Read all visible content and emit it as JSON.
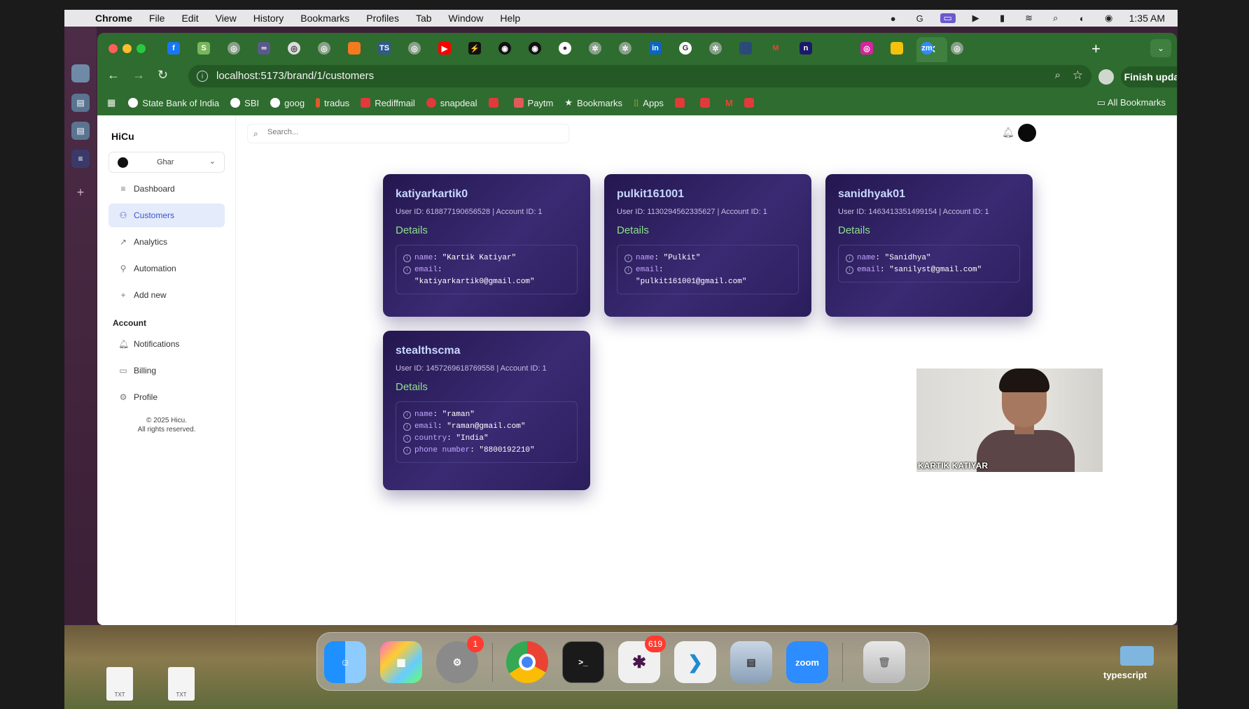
{
  "menubar": {
    "app": "Chrome",
    "items": [
      "File",
      "Edit",
      "View",
      "History",
      "Bookmarks",
      "Profiles",
      "Tab",
      "Window",
      "Help"
    ],
    "time": "1:35 AM"
  },
  "browser": {
    "url": "localhost:5173/brand/1/customers",
    "finish_update": "Finish update",
    "bookmarks": [
      {
        "label": "State Bank of India",
        "color": "#ffffff"
      },
      {
        "label": "SBI",
        "color": "#ffffff"
      },
      {
        "label": "goog",
        "color": "#ffffff"
      },
      {
        "label": "tradus",
        "color": "#e05a2a"
      },
      {
        "label": "Rediffmail",
        "color": "#e03a3a"
      },
      {
        "label": "snapdeal",
        "color": "#e03a3a"
      },
      {
        "label": "",
        "color": "#e03a3a"
      },
      {
        "label": "Paytm",
        "color": "#e05a5a"
      },
      {
        "label": "Bookmarks",
        "color": "#ffffff"
      },
      {
        "label": "Apps",
        "color": "#e0c040"
      }
    ],
    "all_bookmarks": "All Bookmarks"
  },
  "sidebar": {
    "brand": "HiCu",
    "workspace": "Ghar",
    "nav": [
      {
        "label": "Dashboard",
        "icon": "≡"
      },
      {
        "label": "Customers",
        "icon": "👥"
      },
      {
        "label": "Analytics",
        "icon": "↗"
      },
      {
        "label": "Automation",
        "icon": "⚙"
      },
      {
        "label": "Add new",
        "icon": "+"
      }
    ],
    "account_heading": "Account",
    "account_nav": [
      {
        "label": "Notifications",
        "icon": "🔔"
      },
      {
        "label": "Billing",
        "icon": "▭"
      },
      {
        "label": "Profile",
        "icon": "⚙"
      }
    ],
    "copyright_1": "© 2025 Hicu.",
    "copyright_2": "All rights reserved."
  },
  "search": {
    "placeholder": "Search..."
  },
  "customers": [
    {
      "username": "katiyarkartik0",
      "meta": "User ID: 618877190656528 | Account ID: 1",
      "details_label": "Details",
      "fields": [
        {
          "key": "name",
          "value": "\"Kartik Katiyar\""
        },
        {
          "key": "email",
          "value": "\"katiyarkartik0@gmail.com\""
        }
      ]
    },
    {
      "username": "pulkit161001",
      "meta": "User ID: 1130294562335627 | Account ID: 1",
      "details_label": "Details",
      "fields": [
        {
          "key": "name",
          "value": "\"Pulkit\""
        },
        {
          "key": "email",
          "value": "\"pulkit161001@gmail.com\""
        }
      ]
    },
    {
      "username": "sanidhyak01",
      "meta": "User ID: 1463413351499154 | Account ID: 1",
      "details_label": "Details",
      "fields": [
        {
          "key": "name",
          "value": "\"Sanidhya\""
        },
        {
          "key": "email",
          "value": "\"sanilyst@gmail.com\""
        }
      ]
    },
    {
      "username": "stealthscma",
      "meta": "User ID: 1457269618769558 | Account ID: 1",
      "details_label": "Details",
      "fields": [
        {
          "key": "name",
          "value": "\"raman\""
        },
        {
          "key": "email",
          "value": "\"raman@gmail.com\""
        },
        {
          "key": "country",
          "value": "\"India\""
        },
        {
          "key": "phone number",
          "value": "\"8800192210\""
        }
      ]
    }
  ],
  "video": {
    "participant": "KARTIK KATIYAR"
  },
  "dock": {
    "settings_badge": "1",
    "slack_badge": "619",
    "zoom_label": "zoom",
    "typescript_label": "typescript",
    "file_label": "TXT"
  }
}
